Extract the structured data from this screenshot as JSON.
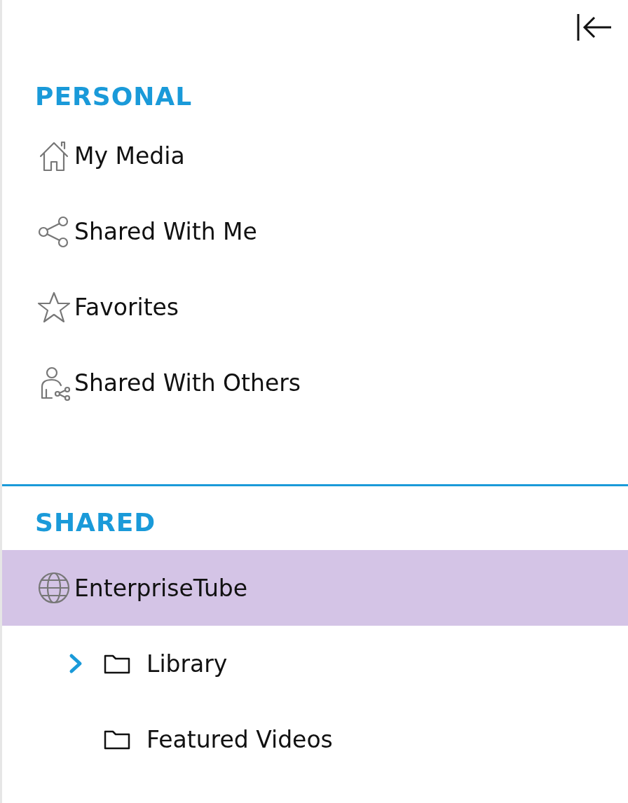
{
  "sections": [
    {
      "heading": "PERSONAL",
      "items": [
        {
          "label": "My Media",
          "selected": false
        },
        {
          "label": "Shared With Me",
          "selected": false
        },
        {
          "label": "Favorites",
          "selected": false
        },
        {
          "label": "Shared With Others",
          "selected": false
        }
      ]
    },
    {
      "heading": "SHARED",
      "items": [
        {
          "label": "EnterpriseTube",
          "selected": true,
          "children": [
            {
              "label": "Library",
              "selected": false,
              "expanded": false
            },
            {
              "label": "Featured Videos",
              "selected": false
            }
          ]
        }
      ]
    }
  ]
}
